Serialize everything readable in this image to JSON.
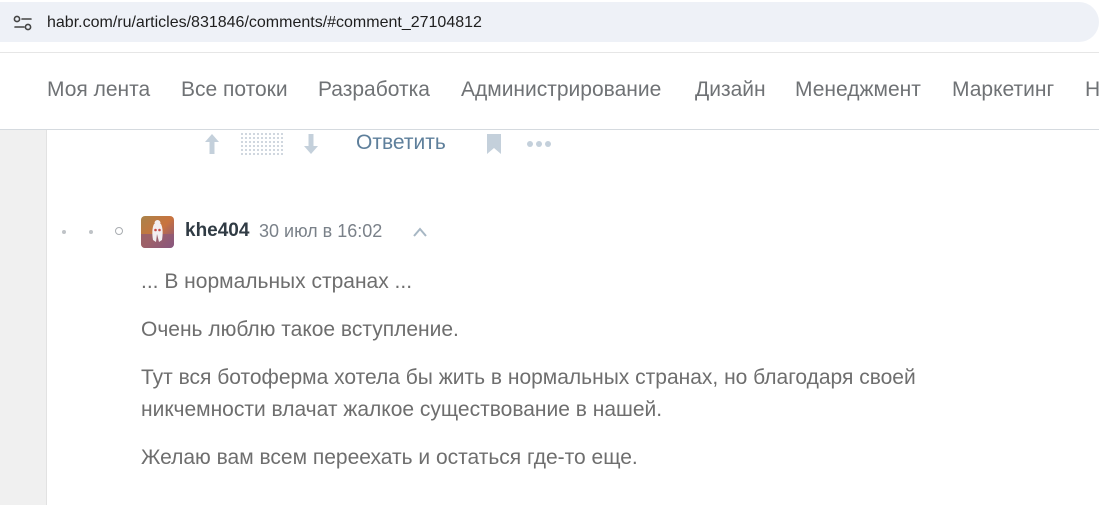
{
  "browser": {
    "url": "habr.com/ru/articles/831846/comments/#comment_27104812"
  },
  "nav": {
    "items": [
      "Моя лента",
      "Все потоки",
      "Разработка",
      "Администрирование",
      "Дизайн",
      "Менеджмент",
      "Маркетинг",
      "Н"
    ]
  },
  "prev_comment": {
    "reply_label": "Ответить"
  },
  "comment": {
    "author": "khe404",
    "time": "30 июл в 16:02",
    "paragraphs": [
      "... В нормальных странах ...",
      "Очень люблю такое вступление.",
      "Тут вся ботоферма хотела бы жить в нормальных странах, но благодаря своей никчемности влачат жалкое существование в нашей.",
      "Желаю вам всем переехать и остаться где-то еще."
    ]
  },
  "colors": {
    "link": "#5e7f9b",
    "text": "#6e6e6e",
    "nav": "#6f7275"
  }
}
